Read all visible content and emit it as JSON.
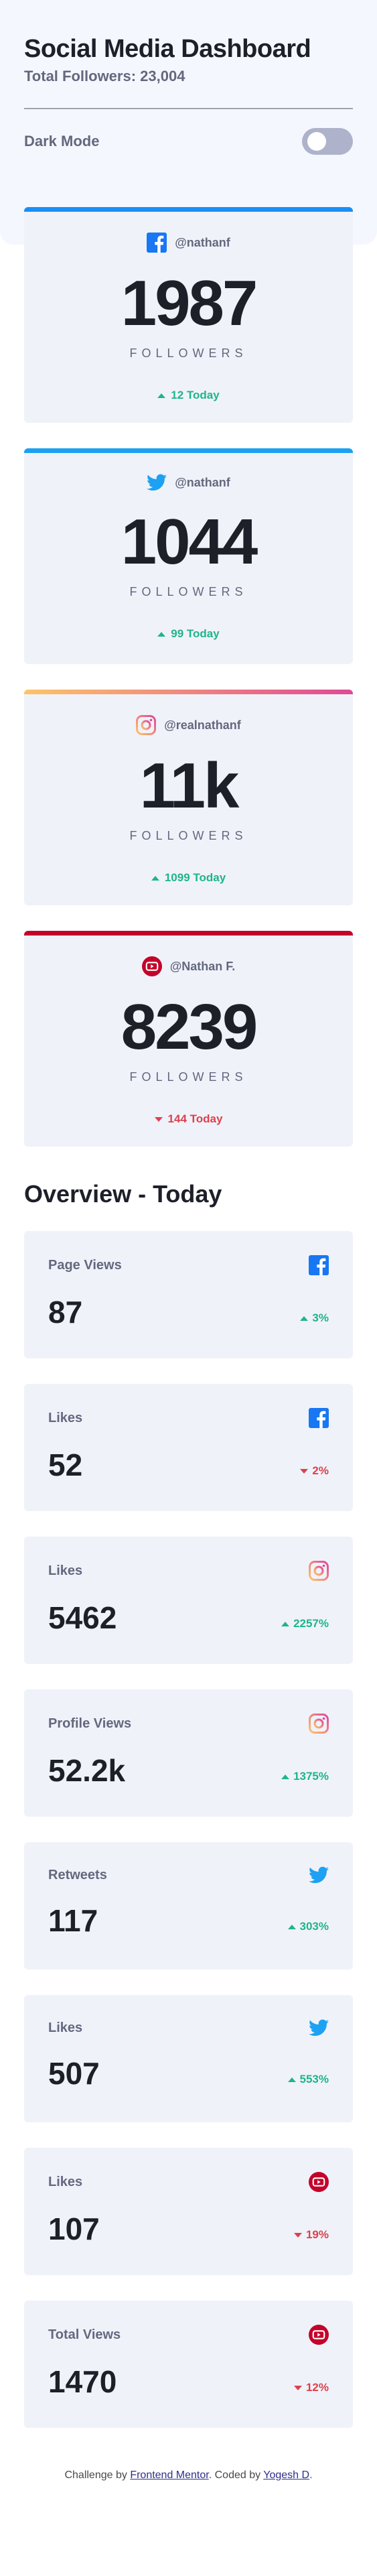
{
  "header": {
    "title": "Social Media Dashboard",
    "total_followers": "Total Followers: 23,004",
    "dark_mode_label": "Dark Mode"
  },
  "followers": [
    {
      "platform": "facebook",
      "icon": "facebook-icon",
      "handle": "@nathanf",
      "count": "1987",
      "label": "FOLLOWERS",
      "today": "12 Today",
      "trend": "up",
      "accent": "#198ff5"
    },
    {
      "platform": "twitter",
      "icon": "twitter-icon",
      "handle": "@nathanf",
      "count": "1044",
      "label": "FOLLOWERS",
      "today": "99 Today",
      "trend": "up",
      "accent": "#1ca0f2"
    },
    {
      "platform": "instagram",
      "icon": "instagram-icon",
      "handle": "@realnathanf",
      "count": "11k",
      "label": "FOLLOWERS",
      "today": "1099 Today",
      "trend": "up",
      "accent": "#df4996"
    },
    {
      "platform": "youtube",
      "icon": "youtube-icon",
      "handle": "@Nathan F.",
      "count": "8239",
      "label": "FOLLOWERS",
      "today": "144 Today",
      "trend": "down",
      "accent": "#c4032a"
    }
  ],
  "overview": {
    "title": "Overview - Today",
    "cards": [
      {
        "metric": "Page Views",
        "icon": "facebook-icon",
        "value": "87",
        "change": "3%",
        "trend": "up"
      },
      {
        "metric": "Likes",
        "icon": "facebook-icon",
        "value": "52",
        "change": "2%",
        "trend": "down"
      },
      {
        "metric": "Likes",
        "icon": "instagram-icon",
        "value": "5462",
        "change": "2257%",
        "trend": "up"
      },
      {
        "metric": "Profile Views",
        "icon": "instagram-icon",
        "value": "52.2k",
        "change": "1375%",
        "trend": "up"
      },
      {
        "metric": "Retweets",
        "icon": "twitter-icon",
        "value": "117",
        "change": "303%",
        "trend": "up"
      },
      {
        "metric": "Likes",
        "icon": "twitter-icon",
        "value": "507",
        "change": "553%",
        "trend": "up"
      },
      {
        "metric": "Likes",
        "icon": "youtube-icon",
        "value": "107",
        "change": "19%",
        "trend": "down"
      },
      {
        "metric": "Total Views",
        "icon": "youtube-icon",
        "value": "1470",
        "change": "12%",
        "trend": "down"
      }
    ]
  },
  "footer": {
    "prefix": "Challenge by",
    "link1": "Frontend Mentor",
    "middle": ". Coded by",
    "link2": "Yogesh D",
    "suffix": "."
  },
  "colors": {
    "up": "#1eb589",
    "down": "#dc414c",
    "instagram_gradient_start": "#fdc468",
    "instagram_gradient_end": "#df4996"
  }
}
